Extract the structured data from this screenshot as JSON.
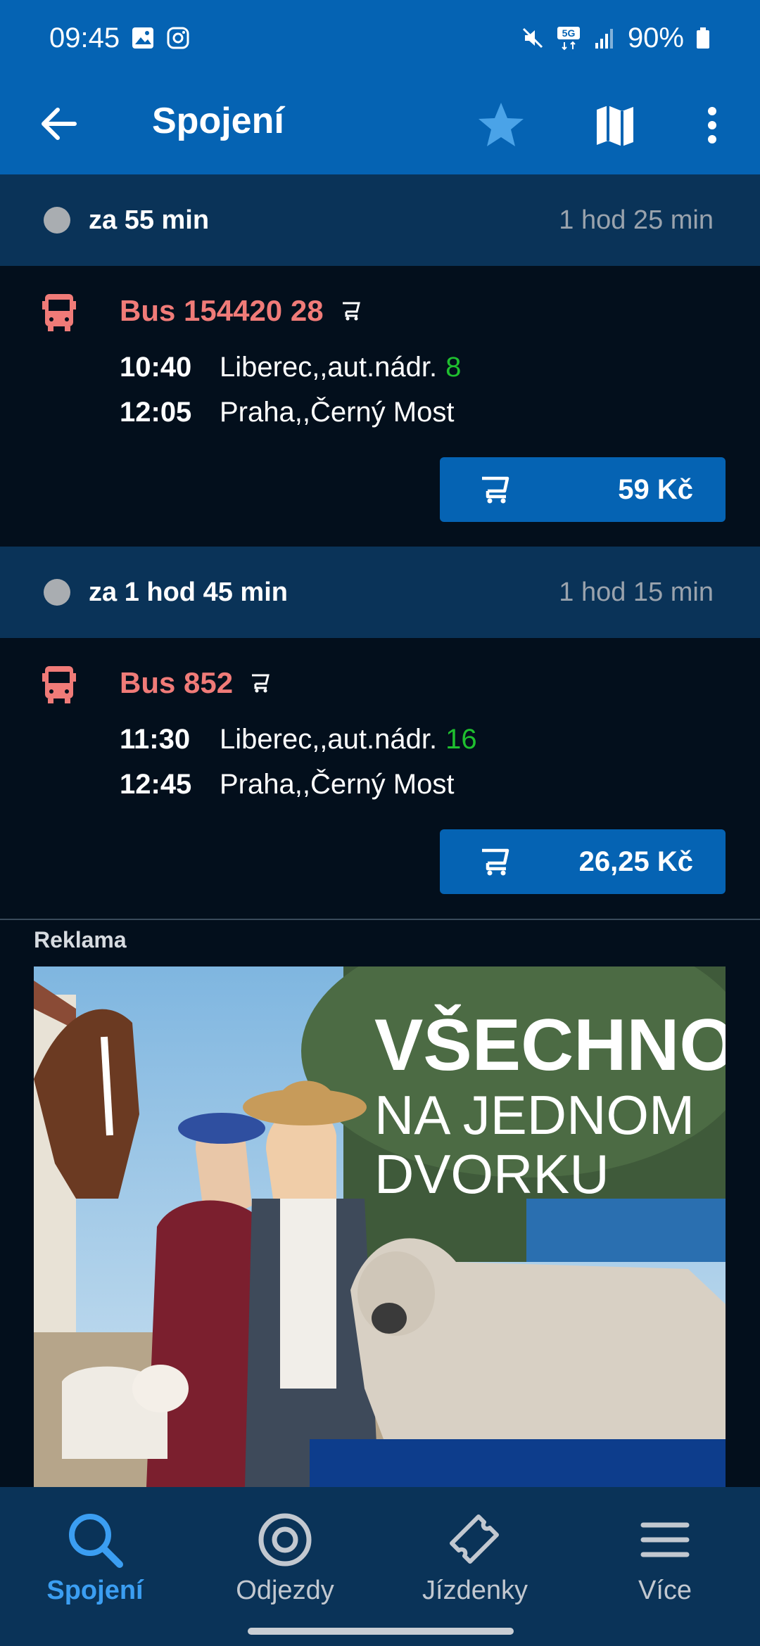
{
  "status": {
    "time": "09:45",
    "battery": "90%"
  },
  "appbar": {
    "title": "Spojení"
  },
  "connections": [
    {
      "header": {
        "when": "za 55 min",
        "duration": "1 hod 25 min"
      },
      "line": "Bus 154420 28",
      "dep_time": "10:40",
      "dep_stop": "Liberec,,aut.nádr.",
      "dep_platform": "8",
      "arr_time": "12:05",
      "arr_stop": "Praha,,Černý Most",
      "price": "59 Kč"
    },
    {
      "header": {
        "when": "za 1 hod 45 min",
        "duration": "1 hod 15 min"
      },
      "line": "Bus 852",
      "dep_time": "11:30",
      "dep_stop": "Liberec,,aut.nádr.",
      "dep_platform": "16",
      "arr_time": "12:45",
      "arr_stop": "Praha,,Černý Most",
      "price": "26,25 Kč"
    }
  ],
  "ad": {
    "label": "Reklama",
    "line1": "VŠECHNO",
    "line2": "NA JEDNOM",
    "line3": "DVORKU"
  },
  "nav": [
    {
      "label": "Spojení",
      "icon": "search-icon"
    },
    {
      "label": "Odjezdy",
      "icon": "target-icon"
    },
    {
      "label": "Jízdenky",
      "icon": "ticket-icon"
    },
    {
      "label": "Více",
      "icon": "menu-icon"
    }
  ],
  "colors": {
    "primary": "#0563b3",
    "header_bg": "#0a3358",
    "bus_red": "#f07b78",
    "platform_green": "#1fbf2f",
    "active_nav": "#3b9ef2"
  }
}
